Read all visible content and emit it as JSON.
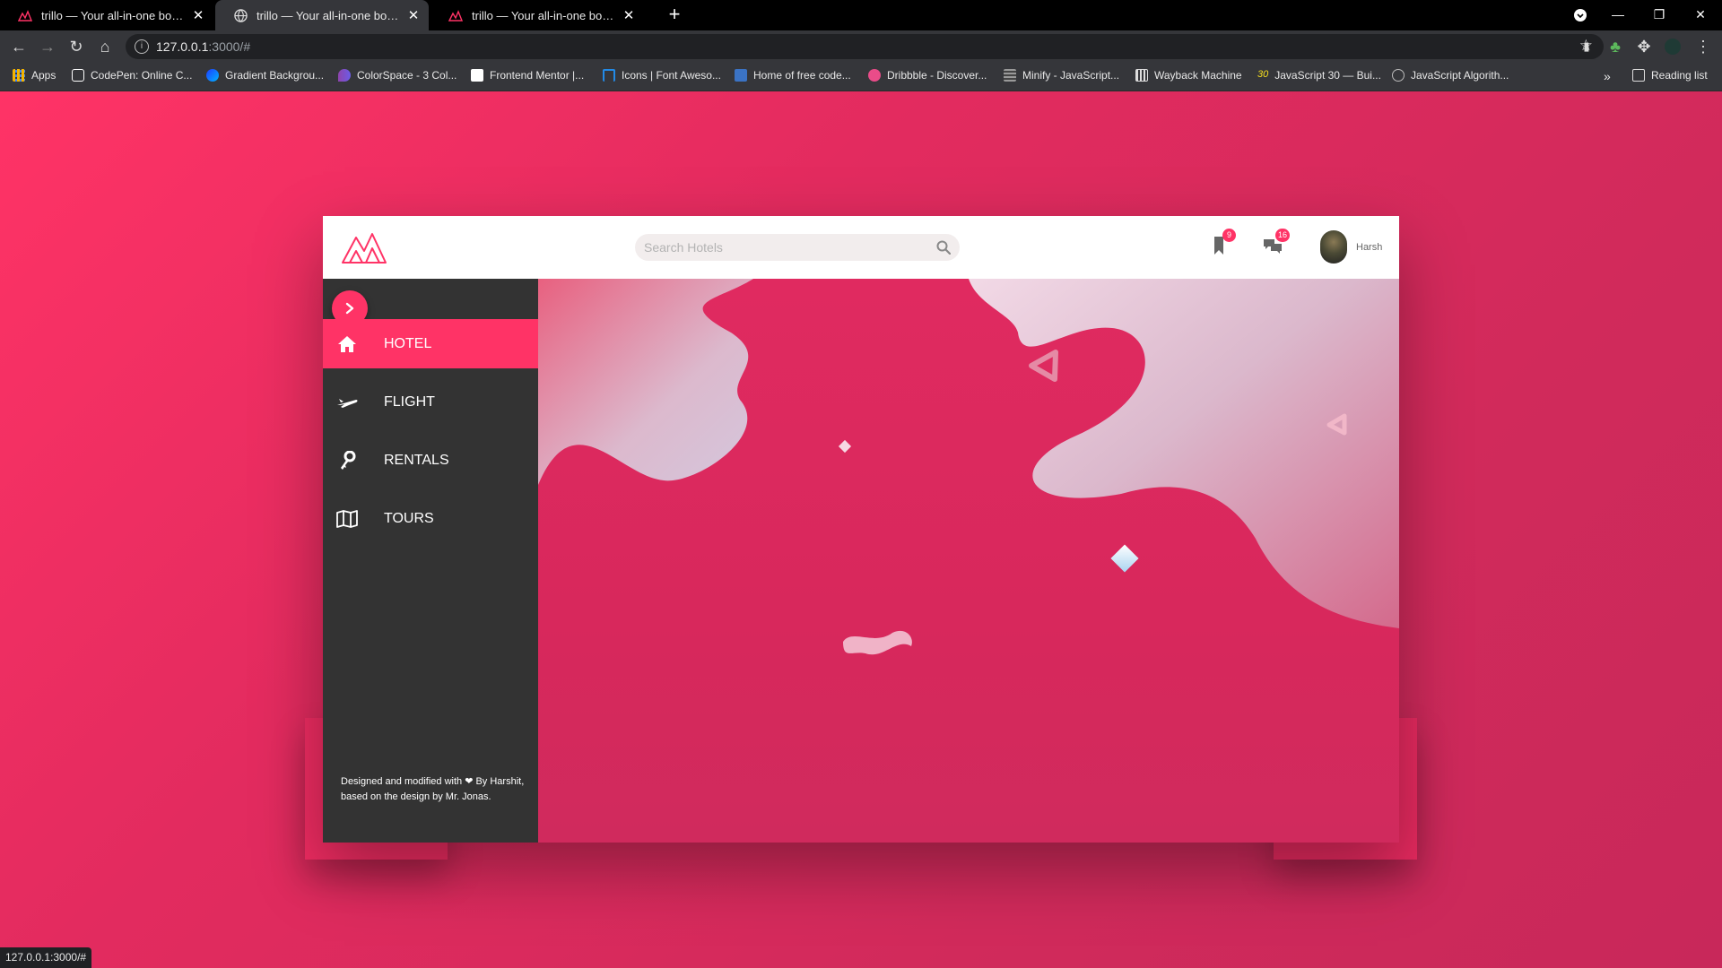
{
  "browser": {
    "tabs": [
      {
        "title": "trillo — Your all-in-one booking app",
        "active": false
      },
      {
        "title": "trillo — Your all-in-one booking app",
        "active": true
      },
      {
        "title": "trillo — Your all-in-one booking app",
        "active": false
      }
    ],
    "url_host": "127.0.0.1",
    "url_rest": ":3000/#",
    "bookmarks": [
      {
        "label": "Apps",
        "icon": "apps-grid-icon",
        "color": "#f4b400"
      },
      {
        "label": "CodePen: Online C...",
        "icon": "codepen-icon",
        "color": "#ffffff"
      },
      {
        "label": "Gradient Backgrou...",
        "icon": "gradient-icon",
        "color": "#2b6cff"
      },
      {
        "label": "ColorSpace - 3 Col...",
        "icon": "colorspace-icon",
        "color": "#8e44ad"
      },
      {
        "label": "Frontend Mentor |...",
        "icon": "frontend-mentor-icon",
        "color": "#ffffff"
      },
      {
        "label": "Icons | Font Aweso...",
        "icon": "font-awesome-flag-icon",
        "color": "#228ae6"
      },
      {
        "label": "Home of free code...",
        "icon": "bootsnipp-icon",
        "color": "#3b73c4"
      },
      {
        "label": "Dribbble - Discover...",
        "icon": "dribbble-icon",
        "color": "#ea4c89"
      },
      {
        "label": "Minify - JavaScript...",
        "icon": "minify-icon",
        "color": "#999999"
      },
      {
        "label": "Wayback Machine",
        "icon": "wayback-icon",
        "color": "#dddddd"
      },
      {
        "label": "JavaScript 30 — Bui...",
        "icon": "js30-icon",
        "color": "#f7df1e"
      },
      {
        "label": "JavaScript Algorith...",
        "icon": "algorithms-icon",
        "color": "#bbbbbb"
      }
    ],
    "reading_list": "Reading list",
    "status_url": "127.0.0.1:3000/#"
  },
  "app": {
    "search": {
      "placeholder": "Search Hotels"
    },
    "bookmarks_badge": "9",
    "messages_badge": "16",
    "user_name": "Harsh",
    "nav": [
      {
        "label": "HOTEL",
        "icon": "home-icon",
        "active": true
      },
      {
        "label": "FLIGHT",
        "icon": "airplane-icon",
        "active": false
      },
      {
        "label": "RENTALS",
        "icon": "key-icon",
        "active": false
      },
      {
        "label": "TOURS",
        "icon": "map-icon",
        "active": false
      }
    ],
    "legal_text": "Designed and modified with ❤ By Harshit, based on the design by Mr. Jonas.",
    "colors": {
      "primary": "#ff3366",
      "sidebar": "#333333",
      "header": "#ffffff"
    }
  }
}
